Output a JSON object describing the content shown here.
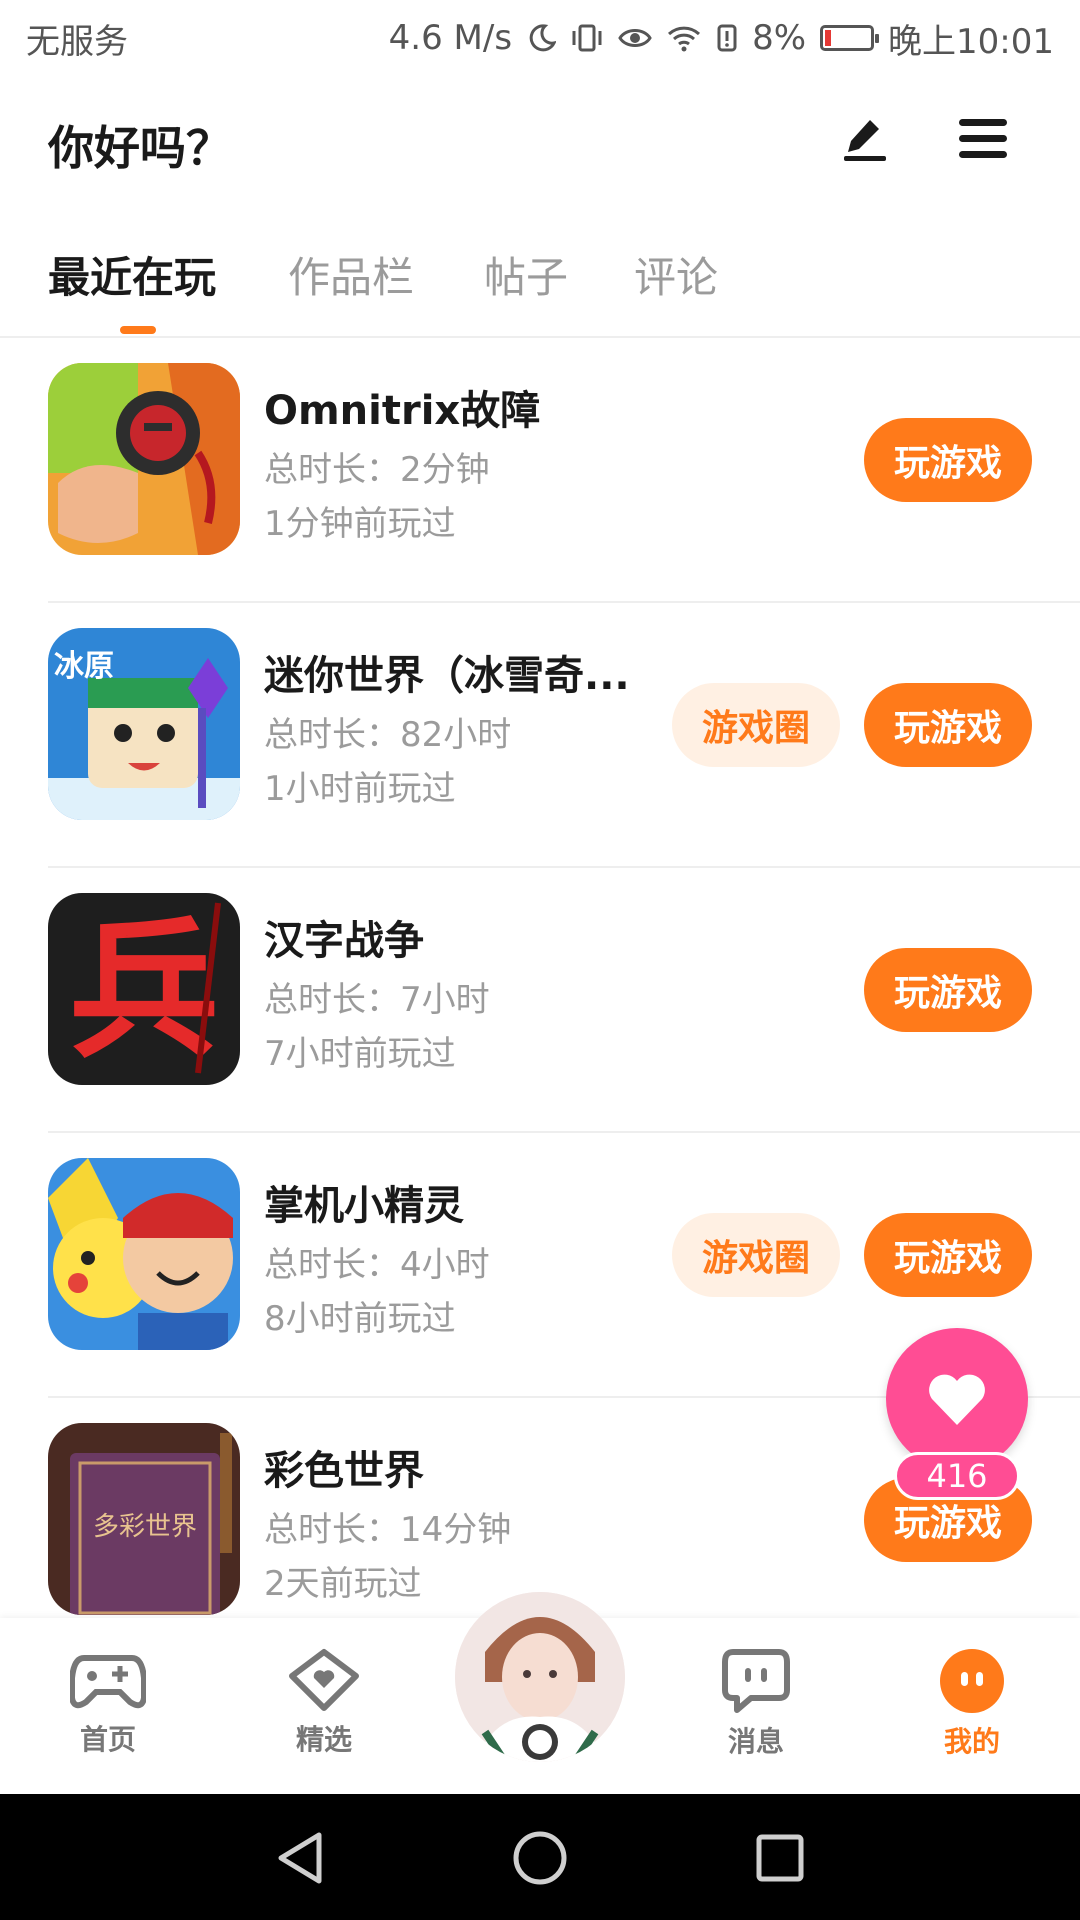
{
  "status_bar": {
    "carrier": "无服务",
    "speed": "4.6 M/s",
    "battery_percent": "8%",
    "time": "晚上10:01"
  },
  "header": {
    "title": "你好吗？",
    "edit_icon": "pen-icon",
    "menu_icon": "menu-icon"
  },
  "tabs": [
    {
      "label": "最近在玩",
      "active": true
    },
    {
      "label": "作品栏",
      "active": false
    },
    {
      "label": "帖子",
      "active": false
    },
    {
      "label": "评论",
      "active": false
    }
  ],
  "games": [
    {
      "name": "Omnitrix故障",
      "duration": "总时长：2分钟",
      "last_played": "1分钟前玩过",
      "circle_button": null,
      "play_button": "玩游戏"
    },
    {
      "name": "迷你世界（冰雪奇...",
      "duration": "总时长：82小时",
      "last_played": "1小时前玩过",
      "circle_button": "游戏圈",
      "play_button": "玩游戏"
    },
    {
      "name": "汉字战争",
      "duration": "总时长：7小时",
      "last_played": "7小时前玩过",
      "circle_button": null,
      "play_button": "玩游戏",
      "icon_text": "兵"
    },
    {
      "name": "掌机小精灵",
      "duration": "总时长：4小时",
      "last_played": "8小时前玩过",
      "circle_button": "游戏圈",
      "play_button": "玩游戏"
    },
    {
      "name": "彩色世界",
      "duration": "总时长：14分钟",
      "last_played": "2天前玩过",
      "circle_button": null,
      "play_button": "玩游戏",
      "icon_text": "多彩世界"
    }
  ],
  "icon_labels": {
    "game1_text": "",
    "game2_text": "冰原"
  },
  "like_fab": {
    "count": "416",
    "icon": "heart-icon"
  },
  "bottom_nav": [
    {
      "label": "首页",
      "icon": "gamepad-icon",
      "active": false
    },
    {
      "label": "精选",
      "icon": "heart-badge-icon",
      "active": false
    },
    {
      "label": "消息",
      "icon": "chat-icon",
      "active": false
    },
    {
      "label": "我的",
      "icon": "face-icon",
      "active": true
    }
  ],
  "colors": {
    "accent": "#ff7a1a",
    "accent_light": "#fff0e3",
    "like": "#ff4d94",
    "muted_text": "#9b9b9b"
  }
}
